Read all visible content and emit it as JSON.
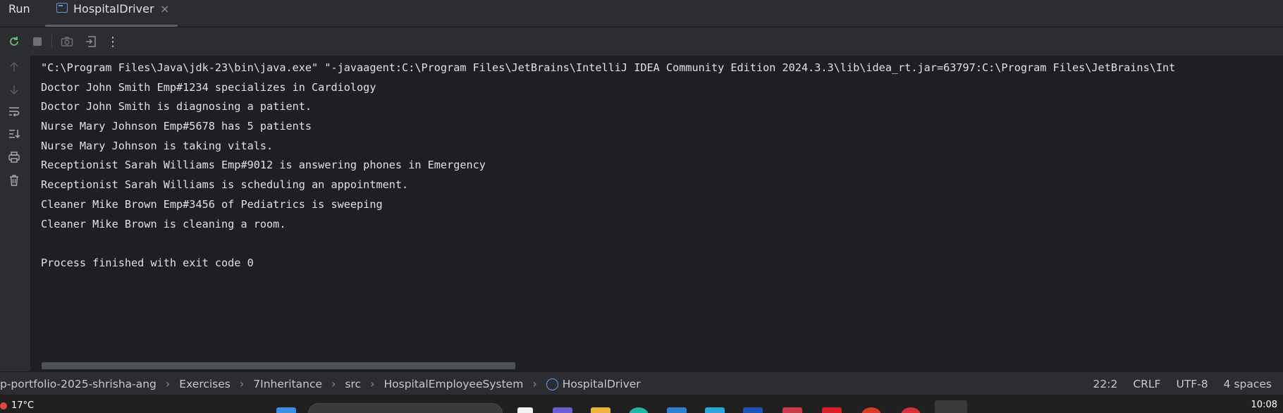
{
  "window": {
    "panel_label": "Run",
    "tab_title": "HospitalDriver",
    "tab_close": "×"
  },
  "toolbar": {
    "icons": [
      "rerun-icon",
      "stop-icon",
      "camera-icon",
      "exit-icon",
      "more-icon"
    ],
    "more_glyph": "⋮"
  },
  "gutter": {
    "icons": [
      "arrow-up-icon",
      "arrow-down-icon",
      "soft-wrap-icon",
      "scroll-to-end-icon",
      "print-icon",
      "trash-icon"
    ]
  },
  "console": {
    "lines": [
      "\"C:\\Program Files\\Java\\jdk-23\\bin\\java.exe\" \"-javaagent:C:\\Program Files\\JetBrains\\IntelliJ IDEA Community Edition 2024.3.3\\lib\\idea_rt.jar=63797:C:\\Program Files\\JetBrains\\Int",
      "Doctor John Smith Emp#1234 specializes in Cardiology",
      "Doctor John Smith is diagnosing a patient.",
      "Nurse Mary Johnson Emp#5678 has 5 patients",
      "Nurse Mary Johnson is taking vitals.",
      "Receptionist Sarah Williams Emp#9012 is answering phones in Emergency",
      "Receptionist Sarah Williams is scheduling an appointment.",
      "Cleaner Mike Brown Emp#3456 of Pediatrics is sweeping",
      "Cleaner Mike Brown is cleaning a room.",
      "",
      "Process finished with exit code 0"
    ]
  },
  "statusbar": {
    "breadcrumbs": [
      "p-portfolio-2025-shrisha-ang",
      "Exercises",
      "7Inheritance",
      "src",
      "HospitalEmployeeSystem",
      "HospitalDriver"
    ],
    "separator": "›",
    "position": "22:2",
    "line_ending": "CRLF",
    "encoding": "UTF-8",
    "indent": "4 spaces"
  },
  "taskbar": {
    "temperature": "17°C",
    "clock": "10:08"
  },
  "colors": {
    "background": "#1e1f22",
    "panel": "#2b2d30",
    "text": "#dfe1e5",
    "accent": "#5aa0e8"
  }
}
